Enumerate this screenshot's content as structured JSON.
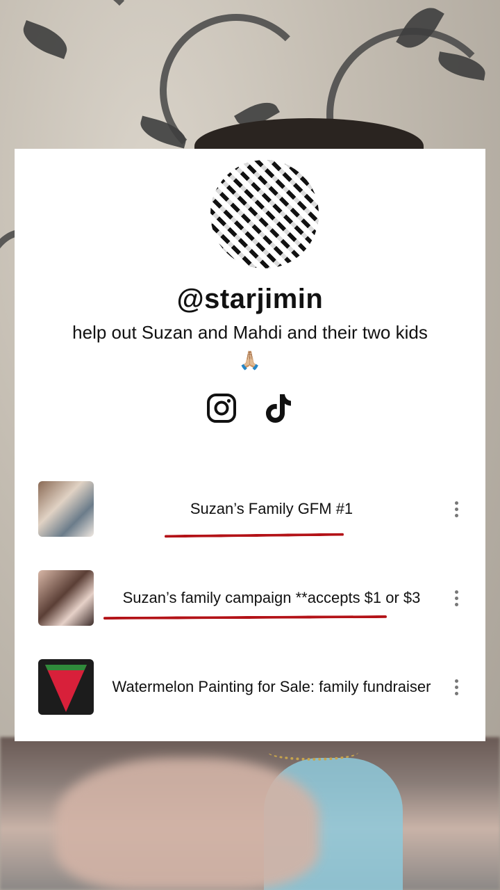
{
  "profile": {
    "username": "@starjimin",
    "bio": "help out Suzan and Mahdi and their two kids 🙏🏼"
  },
  "socials": [
    {
      "icon": "instagram-icon"
    },
    {
      "icon": "tiktok-icon"
    }
  ],
  "links": [
    {
      "title": "Suzan’s Family GFM #1"
    },
    {
      "title": "Suzan’s family campaign **accepts $1 or $3"
    },
    {
      "title": "Watermelon Painting for Sale: family fundraiser"
    }
  ],
  "colors": {
    "card_bg": "#ffffff",
    "text": "#111111",
    "underline": "#b31217",
    "kebab": "#777777"
  }
}
